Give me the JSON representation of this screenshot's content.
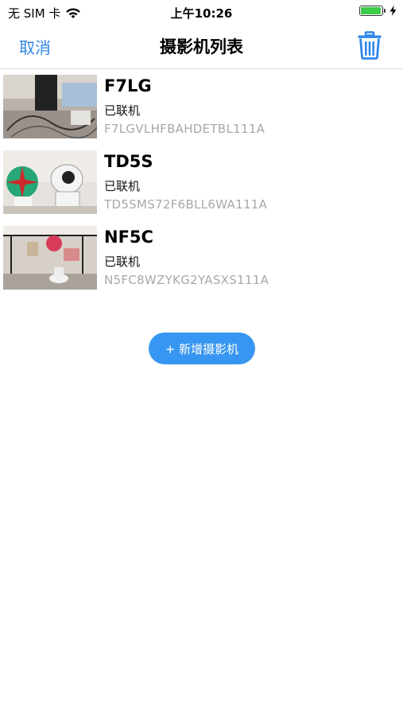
{
  "status_bar": {
    "carrier": "无 SIM 卡",
    "time": "上午10:26",
    "battery_level": 0.95
  },
  "nav": {
    "cancel_label": "取消",
    "title": "摄影机列表",
    "trash_icon": "trash-icon"
  },
  "cameras": [
    {
      "name": "F7LG",
      "status": "已联机",
      "serial": "F7LGVLHFBAHDETBL111A"
    },
    {
      "name": "TD5S",
      "status": "已联机",
      "serial": "TD5SMS72F6BLL6WA111A"
    },
    {
      "name": "NF5C",
      "status": "已联机",
      "serial": "N5FC8WZYKG2YASXS111A"
    }
  ],
  "add_button": {
    "label": "+ 新增摄影机"
  },
  "colors": {
    "accent": "#2f86e8",
    "button": "#3796f1",
    "battery": "#3ccd4a",
    "serial_gray": "#a8a8a8"
  }
}
